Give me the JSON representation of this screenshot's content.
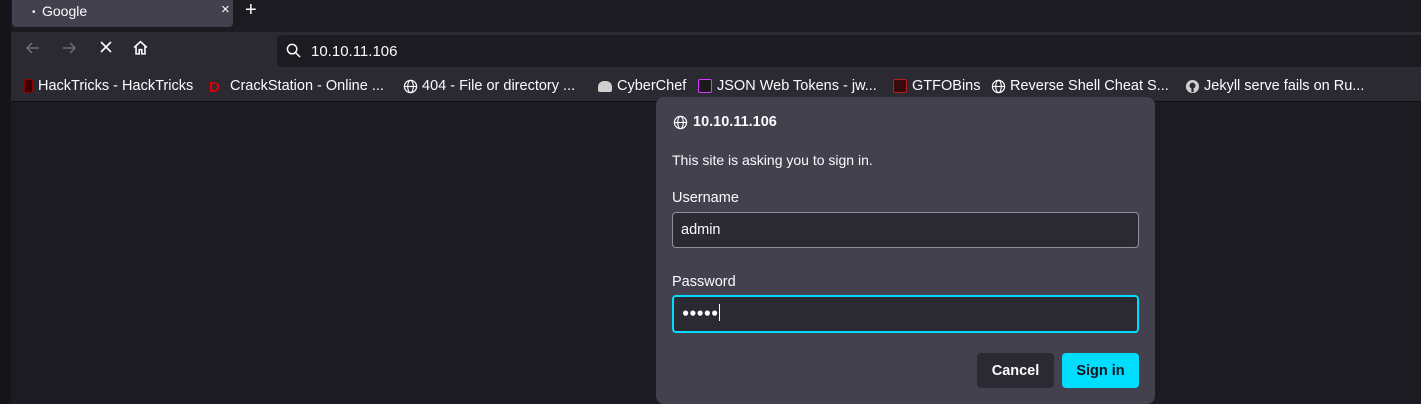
{
  "tab": {
    "title": "Google",
    "close": "×",
    "new_tab": "+"
  },
  "nav": {
    "url": "10.10.11.106"
  },
  "bookmarks": [
    {
      "label": "HackTricks - HackTricks",
      "icon": "hacktricks-icon",
      "color": "#8b0000"
    },
    {
      "label": "CrackStation - Online ...",
      "icon": "crackstation-icon",
      "color": "#cc0000"
    },
    {
      "label": "404 - File or directory ...",
      "icon": "globe-icon",
      "color": ""
    },
    {
      "label": "CyberChef",
      "icon": "cyberchef-icon",
      "color": "#d0d0d0"
    },
    {
      "label": "JSON Web Tokens - jw...",
      "icon": "jwt-icon",
      "color": "#d63aff"
    },
    {
      "label": "GTFOBins",
      "icon": "gtfobins-icon",
      "color": "#b22222"
    },
    {
      "label": "Reverse Shell Cheat S...",
      "icon": "globe-icon",
      "color": ""
    },
    {
      "label": "Jekyll serve fails on Ru...",
      "icon": "github-icon",
      "color": "#d0d0d0"
    }
  ],
  "dialog": {
    "host": "10.10.11.106",
    "message": "This site is asking you to sign in.",
    "username_label": "Username",
    "username_value": "admin",
    "password_label": "Password",
    "password_masked": "●●●●●",
    "cancel_label": "Cancel",
    "signin_label": "Sign in"
  },
  "colors": {
    "accent": "#00ddff",
    "dialog_bg": "#42414d",
    "toolbar_bg": "#2b2a33"
  }
}
